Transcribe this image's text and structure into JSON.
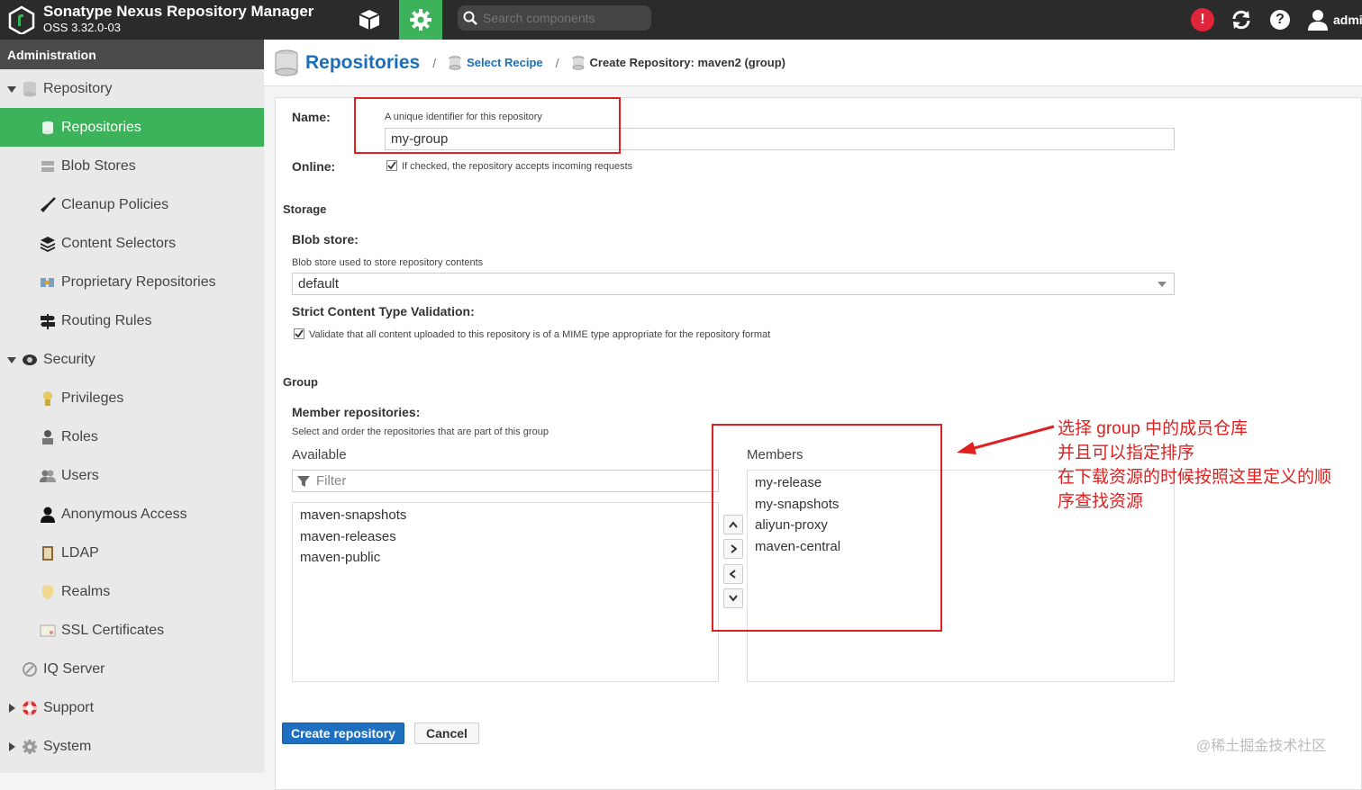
{
  "app": {
    "title": "Sonatype Nexus Repository Manager",
    "version": "OSS 3.32.0-03"
  },
  "topbar": {
    "search_placeholder": "Search components",
    "user": "admi"
  },
  "sidebar": {
    "header": "Administration",
    "items": [
      {
        "label": "Repository"
      },
      {
        "label": "Repositories"
      },
      {
        "label": "Blob Stores"
      },
      {
        "label": "Cleanup Policies"
      },
      {
        "label": "Content Selectors"
      },
      {
        "label": "Proprietary Repositories"
      },
      {
        "label": "Routing Rules"
      },
      {
        "label": "Security"
      },
      {
        "label": "Privileges"
      },
      {
        "label": "Roles"
      },
      {
        "label": "Users"
      },
      {
        "label": "Anonymous Access"
      },
      {
        "label": "LDAP"
      },
      {
        "label": "Realms"
      },
      {
        "label": "SSL Certificates"
      },
      {
        "label": "IQ Server"
      },
      {
        "label": "Support"
      },
      {
        "label": "System"
      }
    ]
  },
  "breadcrumb": {
    "title": "Repositories",
    "sep": "/",
    "recipe": "Select Recipe",
    "current": "Create Repository: maven2 (group)"
  },
  "form": {
    "name_label": "Name:",
    "name_help": "A unique identifier for this repository",
    "name_value": "my-group",
    "online_label": "Online:",
    "online_help": "If checked, the repository accepts incoming requests",
    "storage_title": "Storage",
    "blob_label": "Blob store:",
    "blob_help": "Blob store used to store repository contents",
    "blob_value": "default",
    "strict_label": "Strict Content Type Validation:",
    "strict_help": "Validate that all content uploaded to this repository is of a MIME type appropriate for the repository format",
    "group_title": "Group",
    "members_label": "Member repositories:",
    "members_help": "Select and order the repositories that are part of this group",
    "available_label": "Available",
    "members_list_label": "Members",
    "filter_placeholder": "Filter",
    "available": [
      "maven-snapshots",
      "maven-releases",
      "maven-public"
    ],
    "members": [
      "my-release",
      "my-snapshots",
      "aliyun-proxy",
      "maven-central"
    ],
    "create_button": "Create repository",
    "cancel_button": "Cancel"
  },
  "annotation": {
    "line1": "选择 group 中的成员仓库",
    "line2": "并且可以指定排序",
    "line3": "在下载资源的时候按照这里定义的顺",
    "line4": "序查找资源"
  },
  "watermark": "@稀土掘金技术社区",
  "colors": {
    "accent": "#3cb35a",
    "link": "#1a6fb8",
    "annotation": "#e02020",
    "primary_button": "#1e6fc0"
  }
}
